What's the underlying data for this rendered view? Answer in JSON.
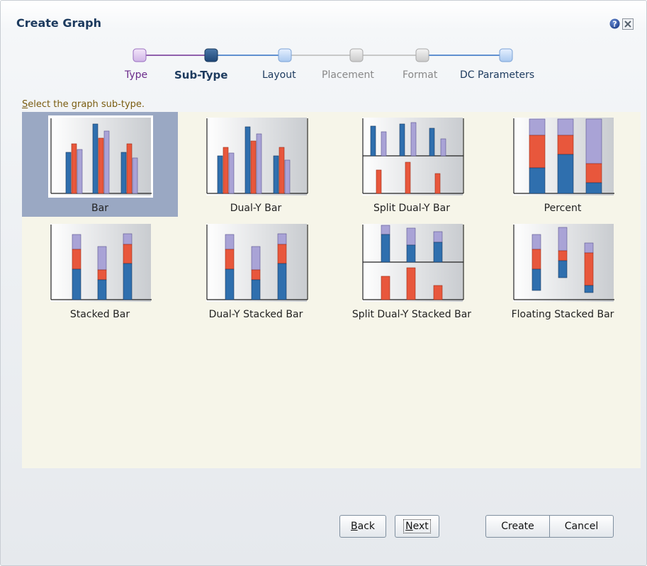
{
  "dialog": {
    "title": "Create Graph"
  },
  "train": {
    "steps": [
      {
        "label": "Type",
        "state": "visited"
      },
      {
        "label": "Sub-Type",
        "state": "current"
      },
      {
        "label": "Layout",
        "state": "next"
      },
      {
        "label": "Placement",
        "state": "disabled"
      },
      {
        "label": "Format",
        "state": "disabled"
      },
      {
        "label": "DC Parameters",
        "state": "next"
      }
    ]
  },
  "prompt": {
    "mnemonic": "S",
    "rest": "elect the graph sub-type."
  },
  "subtypes": [
    {
      "label": "Bar",
      "selected": true
    },
    {
      "label": "Dual-Y Bar",
      "selected": false
    },
    {
      "label": "Split Dual-Y Bar",
      "selected": false
    },
    {
      "label": "Percent",
      "selected": false
    },
    {
      "label": "Stacked Bar",
      "selected": false
    },
    {
      "label": "Dual-Y Stacked Bar",
      "selected": false
    },
    {
      "label": "Split Dual-Y Stacked Bar",
      "selected": false
    },
    {
      "label": "Floating Stacked Bar",
      "selected": false
    }
  ],
  "buttons": {
    "back_mnemonic": "B",
    "back_rest": "ack",
    "next_mnemonic": "N",
    "next_rest": "ext",
    "create_label": "Create",
    "cancel_label": "Cancel"
  },
  "colors": {
    "blue": "#2f6fae",
    "red": "#e8573c",
    "lavender": "#a9a3d6",
    "selection": "#9aa8c3",
    "panel": "#f6f5e9",
    "title": "#1c3a5e"
  },
  "icons": {
    "help": "help-icon",
    "close": "close-icon"
  }
}
